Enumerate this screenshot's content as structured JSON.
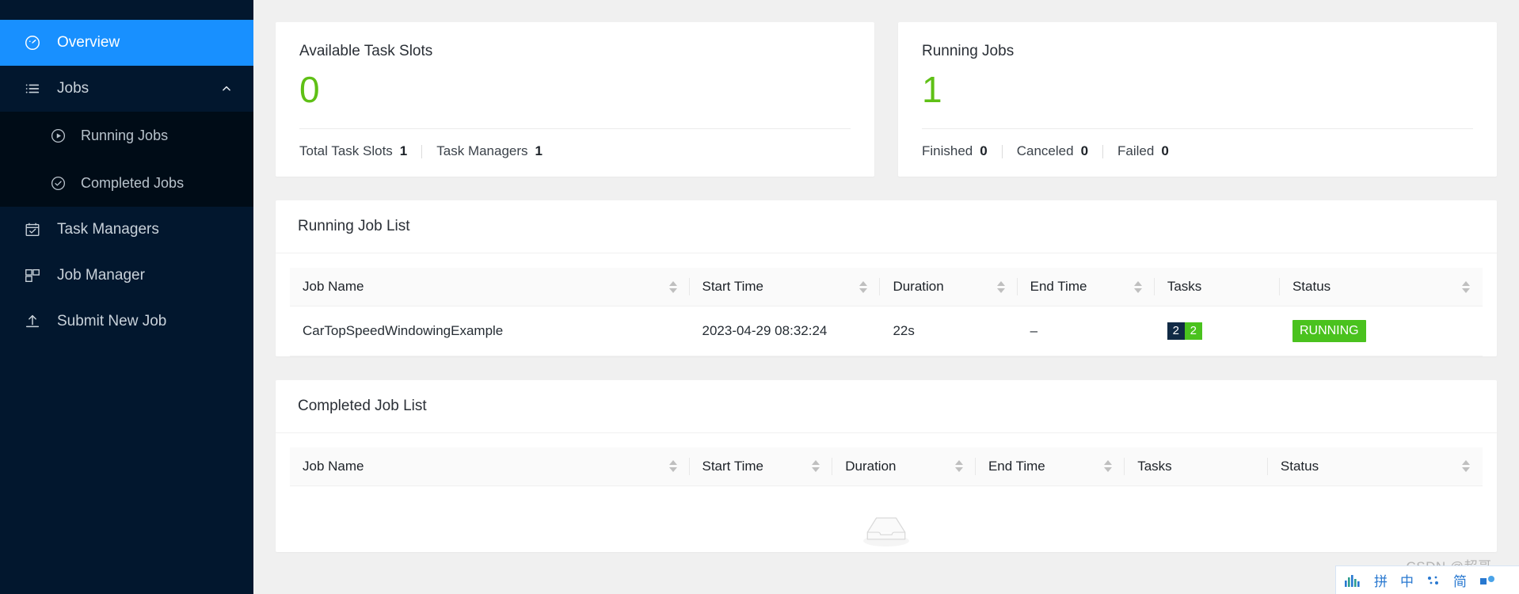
{
  "sidebar": {
    "items": [
      {
        "id": "overview",
        "label": "Overview",
        "icon": "dashboard-icon",
        "active": true
      },
      {
        "id": "jobs",
        "label": "Jobs",
        "icon": "list-icon",
        "active": false,
        "expanded": true
      },
      {
        "id": "running-jobs",
        "label": "Running Jobs",
        "icon": "play-circle-icon",
        "active": false,
        "sub": true
      },
      {
        "id": "completed-jobs",
        "label": "Completed Jobs",
        "icon": "check-circle-icon",
        "active": false,
        "sub": true
      },
      {
        "id": "task-managers",
        "label": "Task Managers",
        "icon": "calendar-check-icon",
        "active": false
      },
      {
        "id": "job-manager",
        "label": "Job Manager",
        "icon": "cluster-icon",
        "active": false
      },
      {
        "id": "submit-new-job",
        "label": "Submit New Job",
        "icon": "upload-icon",
        "active": false
      }
    ],
    "colors": {
      "background": "#02172e",
      "submenu_background": "#000c17",
      "active": "#1890ff"
    }
  },
  "stats": {
    "task_slots": {
      "title": "Available Task Slots",
      "value": "0",
      "value_color": "#5fc016",
      "footer": [
        {
          "label": "Total Task Slots",
          "value": "1"
        },
        {
          "label": "Task Managers",
          "value": "1"
        }
      ]
    },
    "running_jobs": {
      "title": "Running Jobs",
      "value": "1",
      "value_color": "#5fc016",
      "footer": [
        {
          "label": "Finished",
          "value": "0"
        },
        {
          "label": "Canceled",
          "value": "0"
        },
        {
          "label": "Failed",
          "value": "0"
        }
      ]
    }
  },
  "running_job_list": {
    "title": "Running Job List",
    "columns": [
      {
        "label": "Job Name",
        "sortable": true
      },
      {
        "label": "Start Time",
        "sortable": true
      },
      {
        "label": "Duration",
        "sortable": true
      },
      {
        "label": "End Time",
        "sortable": true
      },
      {
        "label": "Tasks",
        "sortable": false
      },
      {
        "label": "Status",
        "sortable": true
      }
    ],
    "rows": [
      {
        "job_name": "CarTopSpeedWindowingExample",
        "start_time": "2023-04-29 08:32:24",
        "duration": "22s",
        "end_time": "–",
        "tasks": [
          {
            "value": "2",
            "color": "#112a45"
          },
          {
            "value": "2",
            "color": "#4ac21e"
          }
        ],
        "status": "RUNNING",
        "status_color": "#4ac21e"
      }
    ]
  },
  "completed_job_list": {
    "title": "Completed Job List",
    "columns": [
      {
        "label": "Job Name",
        "sortable": true
      },
      {
        "label": "Start Time",
        "sortable": true
      },
      {
        "label": "Duration",
        "sortable": true
      },
      {
        "label": "End Time",
        "sortable": true
      },
      {
        "label": "Tasks",
        "sortable": false
      },
      {
        "label": "Status",
        "sortable": true
      }
    ],
    "rows": [],
    "empty_icon": "empty-inbox-icon"
  },
  "watermark": {
    "text": "CSDN @超哥--"
  },
  "ime_bar": {
    "items": [
      {
        "id": "sogou-logo",
        "icon": "sogou-bars-icon",
        "label": ""
      },
      {
        "id": "pinyin-mode",
        "icon": "pin-glyph-icon",
        "label": "拼"
      },
      {
        "id": "lang-mode",
        "icon": "chinese-glyph-icon",
        "label": "中"
      },
      {
        "id": "punctuation-mode",
        "icon": "dots-icon",
        "label": ""
      },
      {
        "id": "simplified-mode",
        "icon": "jian-glyph-icon",
        "label": "简"
      },
      {
        "id": "toolbox",
        "icon": "toolbox-icon",
        "label": ""
      }
    ]
  }
}
